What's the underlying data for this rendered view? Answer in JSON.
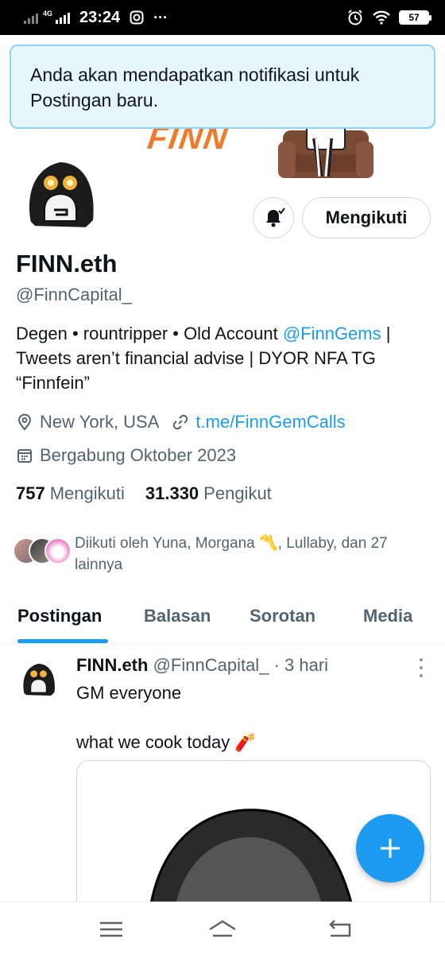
{
  "status_bar": {
    "network": "4G",
    "time": "23:24",
    "more": "···",
    "battery": "57"
  },
  "banner": {
    "logo_text": "FINN"
  },
  "toast": {
    "message": "Anda akan mendapatkan notifikasi untuk Postingan baru."
  },
  "profile": {
    "follow_button": "Mengikuti",
    "display_name": "FINN.eth",
    "handle": "@FinnCapital_",
    "bio_part1": "Degen • rountripper • Old Account ",
    "bio_mention": "@FinnGems",
    "bio_part2": " | Tweets aren’t financial advise | DYOR NFA TG “Finnfein”",
    "location": "New York, USA",
    "website": "t.me/FinnGemCalls",
    "joined": "Bergabung Oktober 2023",
    "following_count": "757",
    "following_label": "Mengikuti",
    "followers_count": "31.330",
    "followers_label": "Pengikut",
    "followed_by": "Diikuti oleh Yuna, Morgana 〽️, Lullaby, dan 27 lainnya"
  },
  "tabs": [
    {
      "label": "Postingan",
      "active": true
    },
    {
      "label": "Balasan",
      "active": false
    },
    {
      "label": "Sorotan",
      "active": false
    },
    {
      "label": "Media",
      "active": false
    }
  ],
  "post": {
    "author_name": "FINN.eth",
    "author_handle": "@FinnCapital_",
    "time": "· 3 hari",
    "text_line1": "GM everyone",
    "text_line2": "what we cook today 🧨"
  },
  "colors": {
    "accent": "#1d9bf0",
    "toast_bg": "#e7f5fd",
    "banner_logo": "#f07a2b"
  },
  "icons": {
    "location": "location-pin-icon",
    "link": "link-icon",
    "calendar": "calendar-icon",
    "bell": "bell-check-icon",
    "compose": "plus-icon",
    "nav_menu": "menu-icon",
    "nav_home": "home-icon",
    "nav_back": "back-icon"
  }
}
